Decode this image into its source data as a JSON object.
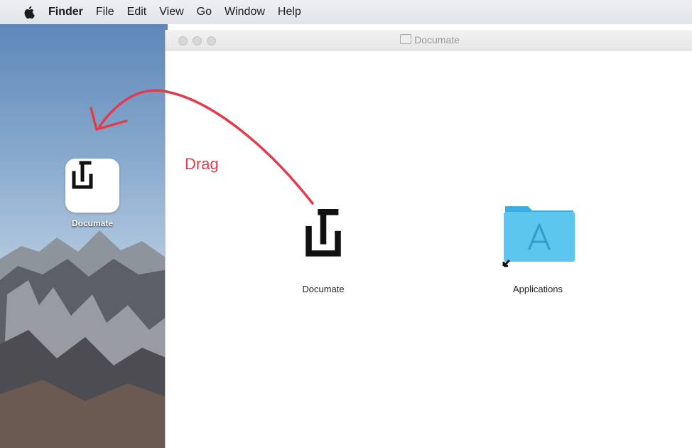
{
  "menubar": {
    "items": [
      "Finder",
      "File",
      "Edit",
      "View",
      "Go",
      "Window",
      "Help"
    ]
  },
  "desktop": {
    "icon_label": "Documate"
  },
  "window": {
    "title": "Documate",
    "items": [
      {
        "label": "Documate",
        "icon": "documate-app-icon"
      },
      {
        "label": "Applications",
        "icon": "applications-folder-icon"
      }
    ]
  },
  "annotation": {
    "text": "Drag",
    "color": "#e23b4a"
  }
}
